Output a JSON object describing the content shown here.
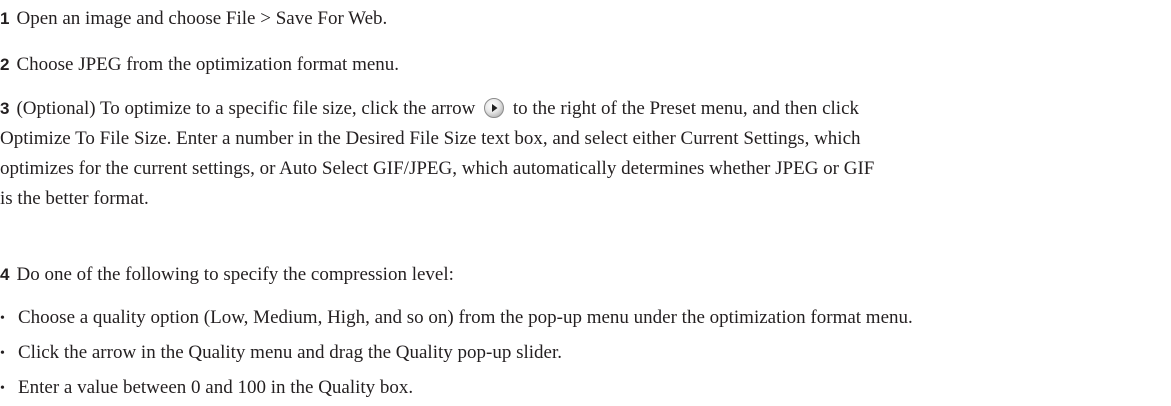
{
  "steps": [
    {
      "number": "1",
      "text": "Open an image and choose File > Save For Web."
    },
    {
      "number": "2",
      "text": "Choose JPEG from the optimization format menu."
    },
    {
      "number": "3",
      "line1_before_icon": "(Optional) To optimize to a specific file size, click the arrow",
      "line1_after_icon": "to the right of the Preset menu, and then click",
      "line2": "Optimize To File Size. Enter a number in the Desired File Size text box, and select either Current Settings, which",
      "line3": "optimizes for the current settings, or Auto Select GIF/JPEG, which automatically determines whether JPEG or GIF",
      "line4": "is the better format.",
      "icon": "circle-arrow-right-icon"
    },
    {
      "number": "4",
      "text": "Do one of the following to specify the compression level:"
    }
  ],
  "bullets": [
    "Choose a quality option (Low, Medium, High, and so on) from the pop-up menu under the optimization format menu.",
    "Click the arrow in the Quality menu and drag the Quality pop-up slider.",
    "Enter a value between 0 and 100 in the Quality box."
  ],
  "bullet_symbol": "•"
}
